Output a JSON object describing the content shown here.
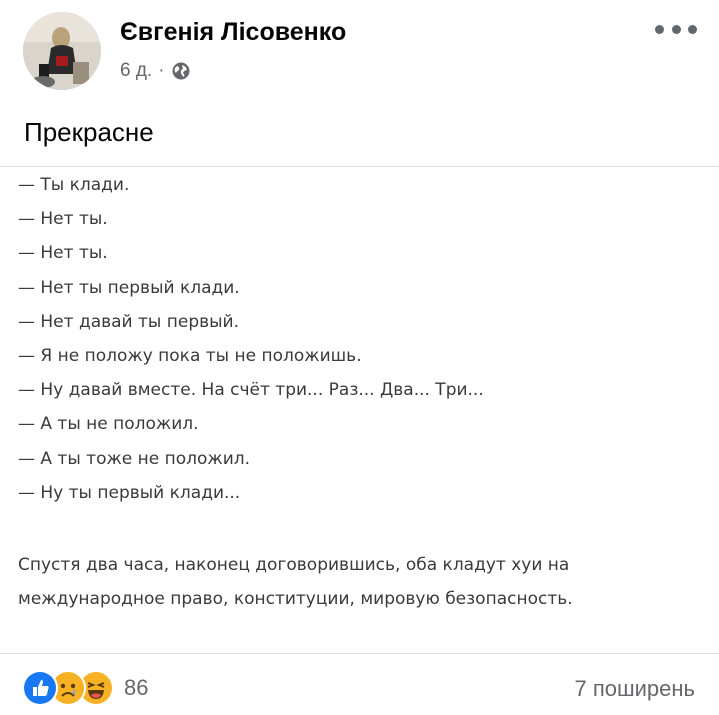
{
  "post": {
    "author": "Євгенія Лісовенко",
    "time": "6 д.",
    "separator": "·",
    "privacy_icon": "globe-icon",
    "more_icon": "more-options-icon",
    "caption": "Прекрасне"
  },
  "image_text": {
    "dialogue": [
      "— Ты клади.",
      "— Нет ты.",
      "— Нет ты.",
      "— Нет ты первый клади.",
      "— Нет давай ты первый.",
      "— Я не положу пока ты не положишь.",
      "— Ну давай вместе. На счёт три... Раз... Два... Три...",
      "— А ты не положил.",
      "— А ты тоже не положил.",
      "— Ну ты первый клади..."
    ],
    "conclusion": "Спустя два часа, наконец договорившись, оба кладут хуи на международное право, конституции, мировую безопасность."
  },
  "footer": {
    "reaction_icons": [
      "like-icon",
      "sad-icon",
      "haha-icon"
    ],
    "reaction_count": "86",
    "shares": "7 поширень"
  },
  "colors": {
    "like": "#1877f2",
    "emoji": "#f7b125",
    "secondary_text": "#65676b",
    "divider": "#dadde1"
  }
}
